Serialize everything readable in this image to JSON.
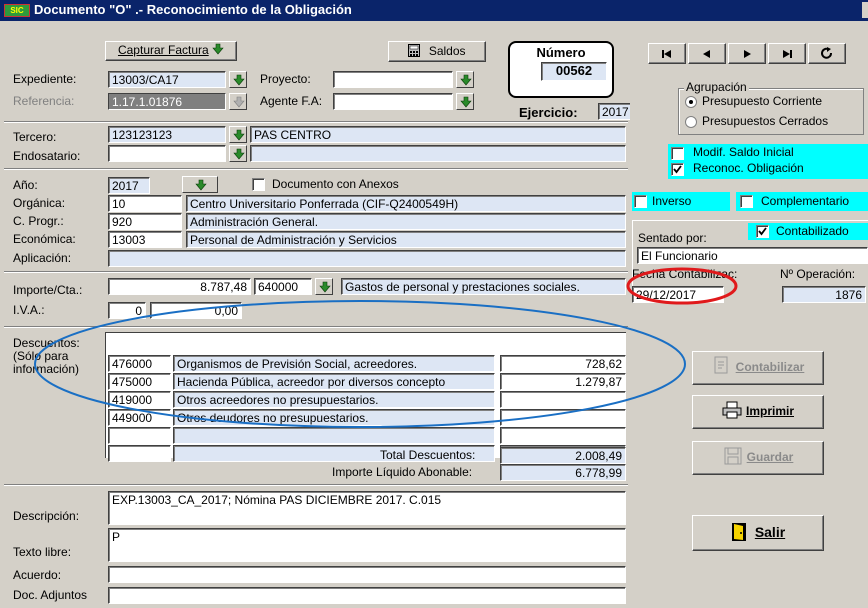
{
  "window": {
    "title": "Documento \"O\" .-  Reconocimiento de la Obligación",
    "logo": "SIC"
  },
  "toolbar": {
    "capturar_factura": "Capturar Factura",
    "saldos": "Saldos"
  },
  "numero": {
    "label": "Número",
    "value": "00562"
  },
  "ejercicio": {
    "label": "Ejercicio:",
    "value": "2017"
  },
  "form": {
    "expediente": {
      "label": "Expediente:",
      "value": "13003/CA17"
    },
    "proyecto": {
      "label": "Proyecto:",
      "value": ""
    },
    "referencia": {
      "label": "Referencia:",
      "value": "1.17.1.01876"
    },
    "agente_fa": {
      "label": "Agente F.A:",
      "value": ""
    },
    "tercero": {
      "label": "Tercero:",
      "code": "123123123",
      "name": "PAS CENTRO"
    },
    "endosatario": {
      "label": "Endosatario:",
      "code": "",
      "name": ""
    },
    "anio": {
      "label": "Año:",
      "value": "2017"
    },
    "doc_anexos": "Documento con Anexos",
    "organica": {
      "label": "Orgánica:",
      "code": "10",
      "desc": "Centro Universitario Ponferrada (CIF-Q2400549H)"
    },
    "cprog": {
      "label": "C. Progr.:",
      "code": "920",
      "desc": "Administración General."
    },
    "economica": {
      "label": "Económica:",
      "code": "13003",
      "desc": "Personal de Administración y Servicios"
    },
    "aplicacion": {
      "label": "Aplicación:",
      "value": ""
    },
    "importe": {
      "label": "Importe/Cta.:",
      "value": "8.787,48",
      "cuenta": "640000",
      "desc": "Gastos de personal y prestaciones sociales."
    },
    "iva": {
      "label": "I.V.A.:",
      "pct": "0",
      "value": "0,00"
    }
  },
  "descuentos": {
    "label": "Descuentos:",
    "note": "(Sólo para información)",
    "rows": [
      {
        "code": "476000",
        "desc": "Organismos de Previsión Social, acreedores.",
        "amount": "728,62"
      },
      {
        "code": "475000",
        "desc": "Hacienda Pública, acreedor por diversos concepto",
        "amount": "1.279,87"
      },
      {
        "code": "419000",
        "desc": "Otros acreedores no presupuestarios.",
        "amount": ""
      },
      {
        "code": "449000",
        "desc": "Otros deudores no presupuestarios.",
        "amount": ""
      },
      {
        "code": "",
        "desc": "",
        "amount": ""
      },
      {
        "code": "",
        "desc": "",
        "amount": ""
      }
    ],
    "total_label": "Total Descuentos:",
    "total_value": "2.008,49",
    "liquido_label": "Importe Líquido Abonable:",
    "liquido_value": "6.778,99"
  },
  "bottom": {
    "descripcion": {
      "label": "Descripción:",
      "value": "EXP.13003_CA_2017; Nómina PAS DICIEMBRE 2017. C.015"
    },
    "texto_libre": {
      "label": "Texto libre:",
      "value": "P"
    },
    "acuerdo": {
      "label": "Acuerdo:",
      "value": ""
    },
    "doc_adjuntos": {
      "label": "Doc. Adjuntos",
      "value": ""
    }
  },
  "right": {
    "agrupacion_label": "Agrupación",
    "opt_corriente": "Presupuesto Corriente",
    "opt_cerrados": "Presupuestos Cerrados",
    "modif_saldo": "Modif. Saldo Inicial",
    "reconoc_obligacion": "Reconoc. Obligación",
    "inverso": "Inverso",
    "complementario": "Complementario",
    "sentado_por_label": "Sentado por:",
    "contabilizado": "Contabilizado",
    "sentado_por_value": "El Funcionario",
    "fecha_label": "Fecha Contabilizac:",
    "fecha_value": "29/12/2017",
    "operacion_label": "Nº Operación:",
    "operacion_value": "1876",
    "btn_contabilizar": "Contabilizar",
    "btn_imprimir": "Imprimir",
    "btn_guardar": "Guardar",
    "btn_salir": "Salir"
  },
  "colors": {
    "title_bar": "#0a246a",
    "face": "#d4d0c8",
    "readonly_field": "#dde6f4",
    "highlight_cyan": "#00ffff",
    "annotation_blue": "#1a6fc4",
    "annotation_red": "#e0191b"
  }
}
